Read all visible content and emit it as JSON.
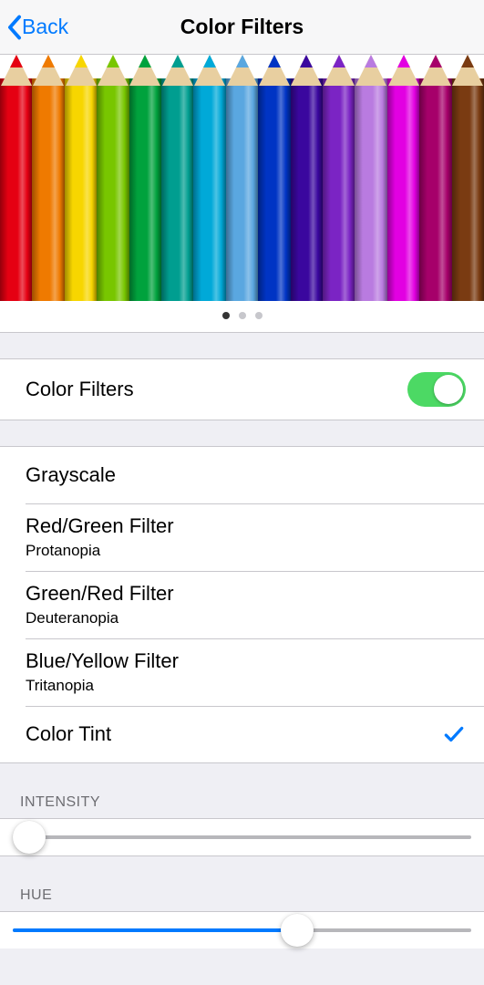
{
  "nav": {
    "back": "Back",
    "title": "Color Filters"
  },
  "preview": {
    "page_index": 0,
    "page_count": 3,
    "pencil_colors": [
      "#e50012",
      "#ef7a00",
      "#f7d600",
      "#78c600",
      "#00a23d",
      "#009e90",
      "#00a9d8",
      "#5aa7e0",
      "#0034c4",
      "#3a079e",
      "#7b24c4",
      "#b97be0",
      "#e200e2",
      "#a6006a",
      "#7a3b12"
    ]
  },
  "toggle": {
    "label": "Color Filters",
    "on": true
  },
  "filters": [
    {
      "title": "Grayscale",
      "subtitle": "",
      "selected": false
    },
    {
      "title": "Red/Green Filter",
      "subtitle": "Protanopia",
      "selected": false
    },
    {
      "title": "Green/Red Filter",
      "subtitle": "Deuteranopia",
      "selected": false
    },
    {
      "title": "Blue/Yellow Filter",
      "subtitle": "Tritanopia",
      "selected": false
    },
    {
      "title": "Color Tint",
      "subtitle": "",
      "selected": true
    }
  ],
  "sliders": {
    "intensity": {
      "header": "INTENSITY",
      "value": 0
    },
    "hue": {
      "header": "HUE",
      "value": 62
    }
  }
}
